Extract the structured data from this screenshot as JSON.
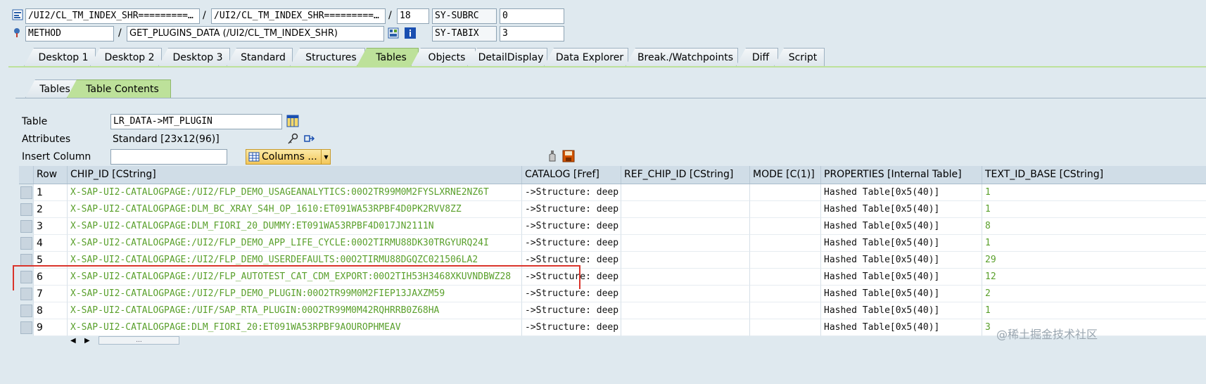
{
  "header": {
    "row1": {
      "field1": "/UI2/CL_TM_INDEX_SHR=========…",
      "sep1": "/",
      "field2": "/UI2/CL_TM_INDEX_SHR=========…",
      "sep2": "/",
      "line": "18",
      "sysname": "SY-SUBRC",
      "sysval": "0"
    },
    "row2": {
      "kind": "METHOD",
      "sep": "/",
      "name": "GET_PLUGINS_DATA (/UI2/CL_TM_INDEX_SHR)",
      "sysname": "SY-TABIX",
      "sysval": "3"
    }
  },
  "tabs": [
    "Desktop 1",
    "Desktop 2",
    "Desktop 3",
    "Standard",
    "Structures",
    "Tables",
    "Objects",
    "DetailDisplay",
    "Data Explorer",
    "Break./Watchpoints",
    "Diff",
    "Script"
  ],
  "subtabs": [
    "Tables",
    "Table Contents"
  ],
  "form": {
    "table_label": "Table",
    "table_value": "LR_DATA->MT_PLUGIN",
    "attributes_label": "Attributes",
    "attributes_value": "Standard [23x12(96)]",
    "insert_label": "Insert Column",
    "insert_value": "",
    "columns_button": "Columns ..."
  },
  "table": {
    "headers": [
      "Row",
      "CHIP_ID [CString]",
      "CATALOG [Fref]",
      "REF_CHIP_ID [CString]",
      "MODE [C(1)]",
      "PROPERTIES [Internal Table]",
      "TEXT_ID_BASE [CString]"
    ],
    "rows": [
      [
        "1",
        "X-SAP-UI2-CATALOGPAGE:/UI2/FLP_DEMO_USAGEANALYTICS:00O2TR99M0M2FYSLXRNE2NZ6T",
        "->Structure: deep",
        "",
        "",
        "Hashed Table[0x5(40)]",
        "1"
      ],
      [
        "2",
        "X-SAP-UI2-CATALOGPAGE:DLM_BC_XRAY_S4H_OP_1610:ET091WA53RPBF4D0PK2RVV8ZZ",
        "->Structure: deep",
        "",
        "",
        "Hashed Table[0x5(40)]",
        "1"
      ],
      [
        "3",
        "X-SAP-UI2-CATALOGPAGE:DLM_FIORI_20_DUMMY:ET091WA53RPBF4D017JN2111N",
        "->Structure: deep",
        "",
        "",
        "Hashed Table[0x5(40)]",
        "8"
      ],
      [
        "4",
        "X-SAP-UI2-CATALOGPAGE:/UI2/FLP_DEMO_APP_LIFE_CYCLE:00O2TIRMU88DK30TRGYURQ24I",
        "->Structure: deep",
        "",
        "",
        "Hashed Table[0x5(40)]",
        "1"
      ],
      [
        "5",
        "X-SAP-UI2-CATALOGPAGE:/UI2/FLP_DEMO_USERDEFAULTS:00O2TIRMU88DGQZC021506LA2",
        "->Structure: deep",
        "",
        "",
        "Hashed Table[0x5(40)]",
        "29"
      ],
      [
        "6",
        "X-SAP-UI2-CATALOGPAGE:/UI2/FLP_AUTOTEST_CAT_CDM_EXPORT:00O2TIH53H3468XKUVNDBWZ28",
        "->Structure: deep",
        "",
        "",
        "Hashed Table[0x5(40)]",
        "12"
      ],
      [
        "7",
        "X-SAP-UI2-CATALOGPAGE:/UI2/FLP_DEMO_PLUGIN:00O2TR99M0M2FIEP13JAXZM59",
        "->Structure: deep",
        "",
        "",
        "Hashed Table[0x5(40)]",
        "2"
      ],
      [
        "8",
        "X-SAP-UI2-CATALOGPAGE:/UIF/SAP_RTA_PLUGIN:00O2TR99M0M42RQHRRB0Z68HA",
        "->Structure: deep",
        "",
        "",
        "Hashed Table[0x5(40)]",
        "1"
      ],
      [
        "9",
        "X-SAP-UI2-CATALOGPAGE:DLM_FIORI_20:ET091WA53RPBF9AOUROPHMEAV",
        "->Structure: deep",
        "",
        "",
        "Hashed Table[0x5(40)]",
        "3"
      ]
    ]
  },
  "scroll": {
    "dots": "..."
  },
  "watermark": "@稀土掘金技术社区",
  "colors": {
    "accent": "#bde19a",
    "green_text": "#5aa02c",
    "annotation": "#d9342b"
  },
  "icons": [
    "source-code-icon",
    "method-icon",
    "display-object-icon",
    "info-icon",
    "table-view-icon",
    "key-icon",
    "share-icon",
    "grid-icon",
    "dropdown-arrow-icon",
    "bottle-icon",
    "save-icon"
  ]
}
